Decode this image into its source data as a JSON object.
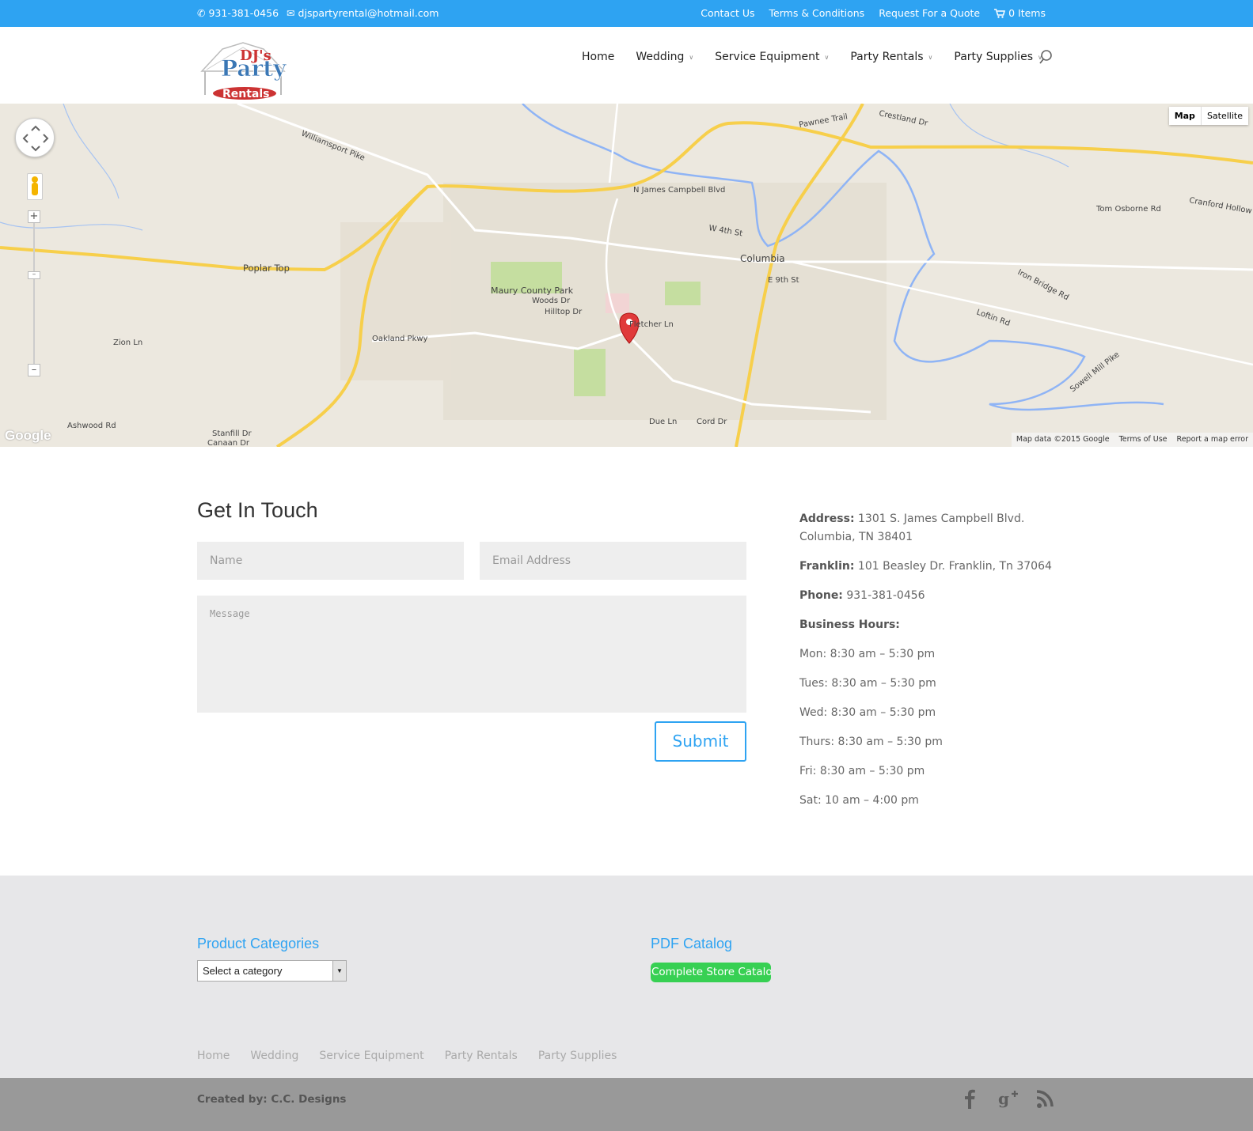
{
  "topbar": {
    "phone": "931-381-0456",
    "email": "djspartyrental@hotmail.com",
    "links": [
      "Contact Us",
      "Terms & Conditions",
      "Request For a Quote"
    ],
    "cart": "0 Items"
  },
  "nav": {
    "items": [
      {
        "label": "Home",
        "dropdown": false
      },
      {
        "label": "Wedding",
        "dropdown": true
      },
      {
        "label": "Service Equipment",
        "dropdown": true
      },
      {
        "label": "Party Rentals",
        "dropdown": true
      },
      {
        "label": "Party Supplies",
        "dropdown": true
      }
    ]
  },
  "map": {
    "type_buttons": [
      "Map",
      "Satellite"
    ],
    "active_type": "Map",
    "footer": [
      "Map data ©2015 Google",
      "Terms of Use",
      "Report a map error"
    ],
    "labels": {
      "columbia": "Columbia",
      "poplar_top": "Poplar Top",
      "maury_park": "Maury County Park",
      "williamsport": "Williamsport Pike",
      "n_james": "N James Campbell Blvd",
      "e9th": "E 9th St",
      "zion": "Zion Ln",
      "oakland": "Oakland Pkwy",
      "iron_bridge": "Iron Bridge Rd",
      "cranford": "Cranford Hollow Rd",
      "tom_osborne": "Tom Osborne Rd",
      "sowell": "Sowell Mill Pike",
      "cord": "Cord Dr",
      "due": "Due Ln",
      "ashwood": "Ashwood Rd",
      "stanfill": "Stanfill Dr",
      "canaan": "Canaan Dr",
      "pawnee": "Pawnee Trail",
      "crestland": "Crestland Dr",
      "w4th": "W 4th St",
      "woods": "Woods Dr",
      "hilltop": "Hilltop Dr",
      "fletcher": "Fletcher Ln",
      "loftin": "Loftin Rd"
    },
    "google": "Google"
  },
  "contact": {
    "title": "Get In Touch",
    "name_placeholder": "Name",
    "email_placeholder": "Email Address",
    "message_placeholder": "Message",
    "submit": "Submit"
  },
  "info": {
    "address_label": "Address:",
    "address_line1": "1301 S. James Campbell Blvd.",
    "address_line2": "Columbia, TN 38401",
    "franklin_label": "Franklin:",
    "franklin_value": "101 Beasley Dr. Franklin, Tn 37064",
    "phone_label": "Phone:",
    "phone_value": "931-381-0456",
    "hours_label": "Business Hours:",
    "hours": [
      "Mon: 8:30 am – 5:30 pm",
      "Tues: 8:30 am – 5:30 pm",
      "Wed: 8:30 am – 5:30 pm",
      "Thurs: 8:30 am – 5:30 pm",
      "Fri: 8:30 am – 5:30 pm",
      "Sat: 10 am – 4:00 pm"
    ]
  },
  "footer": {
    "product_title": "Product Categories",
    "select_value": "Select a category",
    "pdf_title": "PDF Catalog",
    "catalog_button": "Complete Store Catalog",
    "nav": [
      "Home",
      "Wedding",
      "Service Equipment",
      "Party Rentals",
      "Party Supplies"
    ],
    "credit": "Created by: C.C. Designs",
    "social": [
      "facebook-icon",
      "google-plus-icon",
      "rss-icon"
    ]
  },
  "colors": {
    "accent": "#2ea3f2",
    "catalog_green": "#37d053",
    "footer_bg": "#e7e7e9",
    "bottom_bar": "#999999"
  }
}
